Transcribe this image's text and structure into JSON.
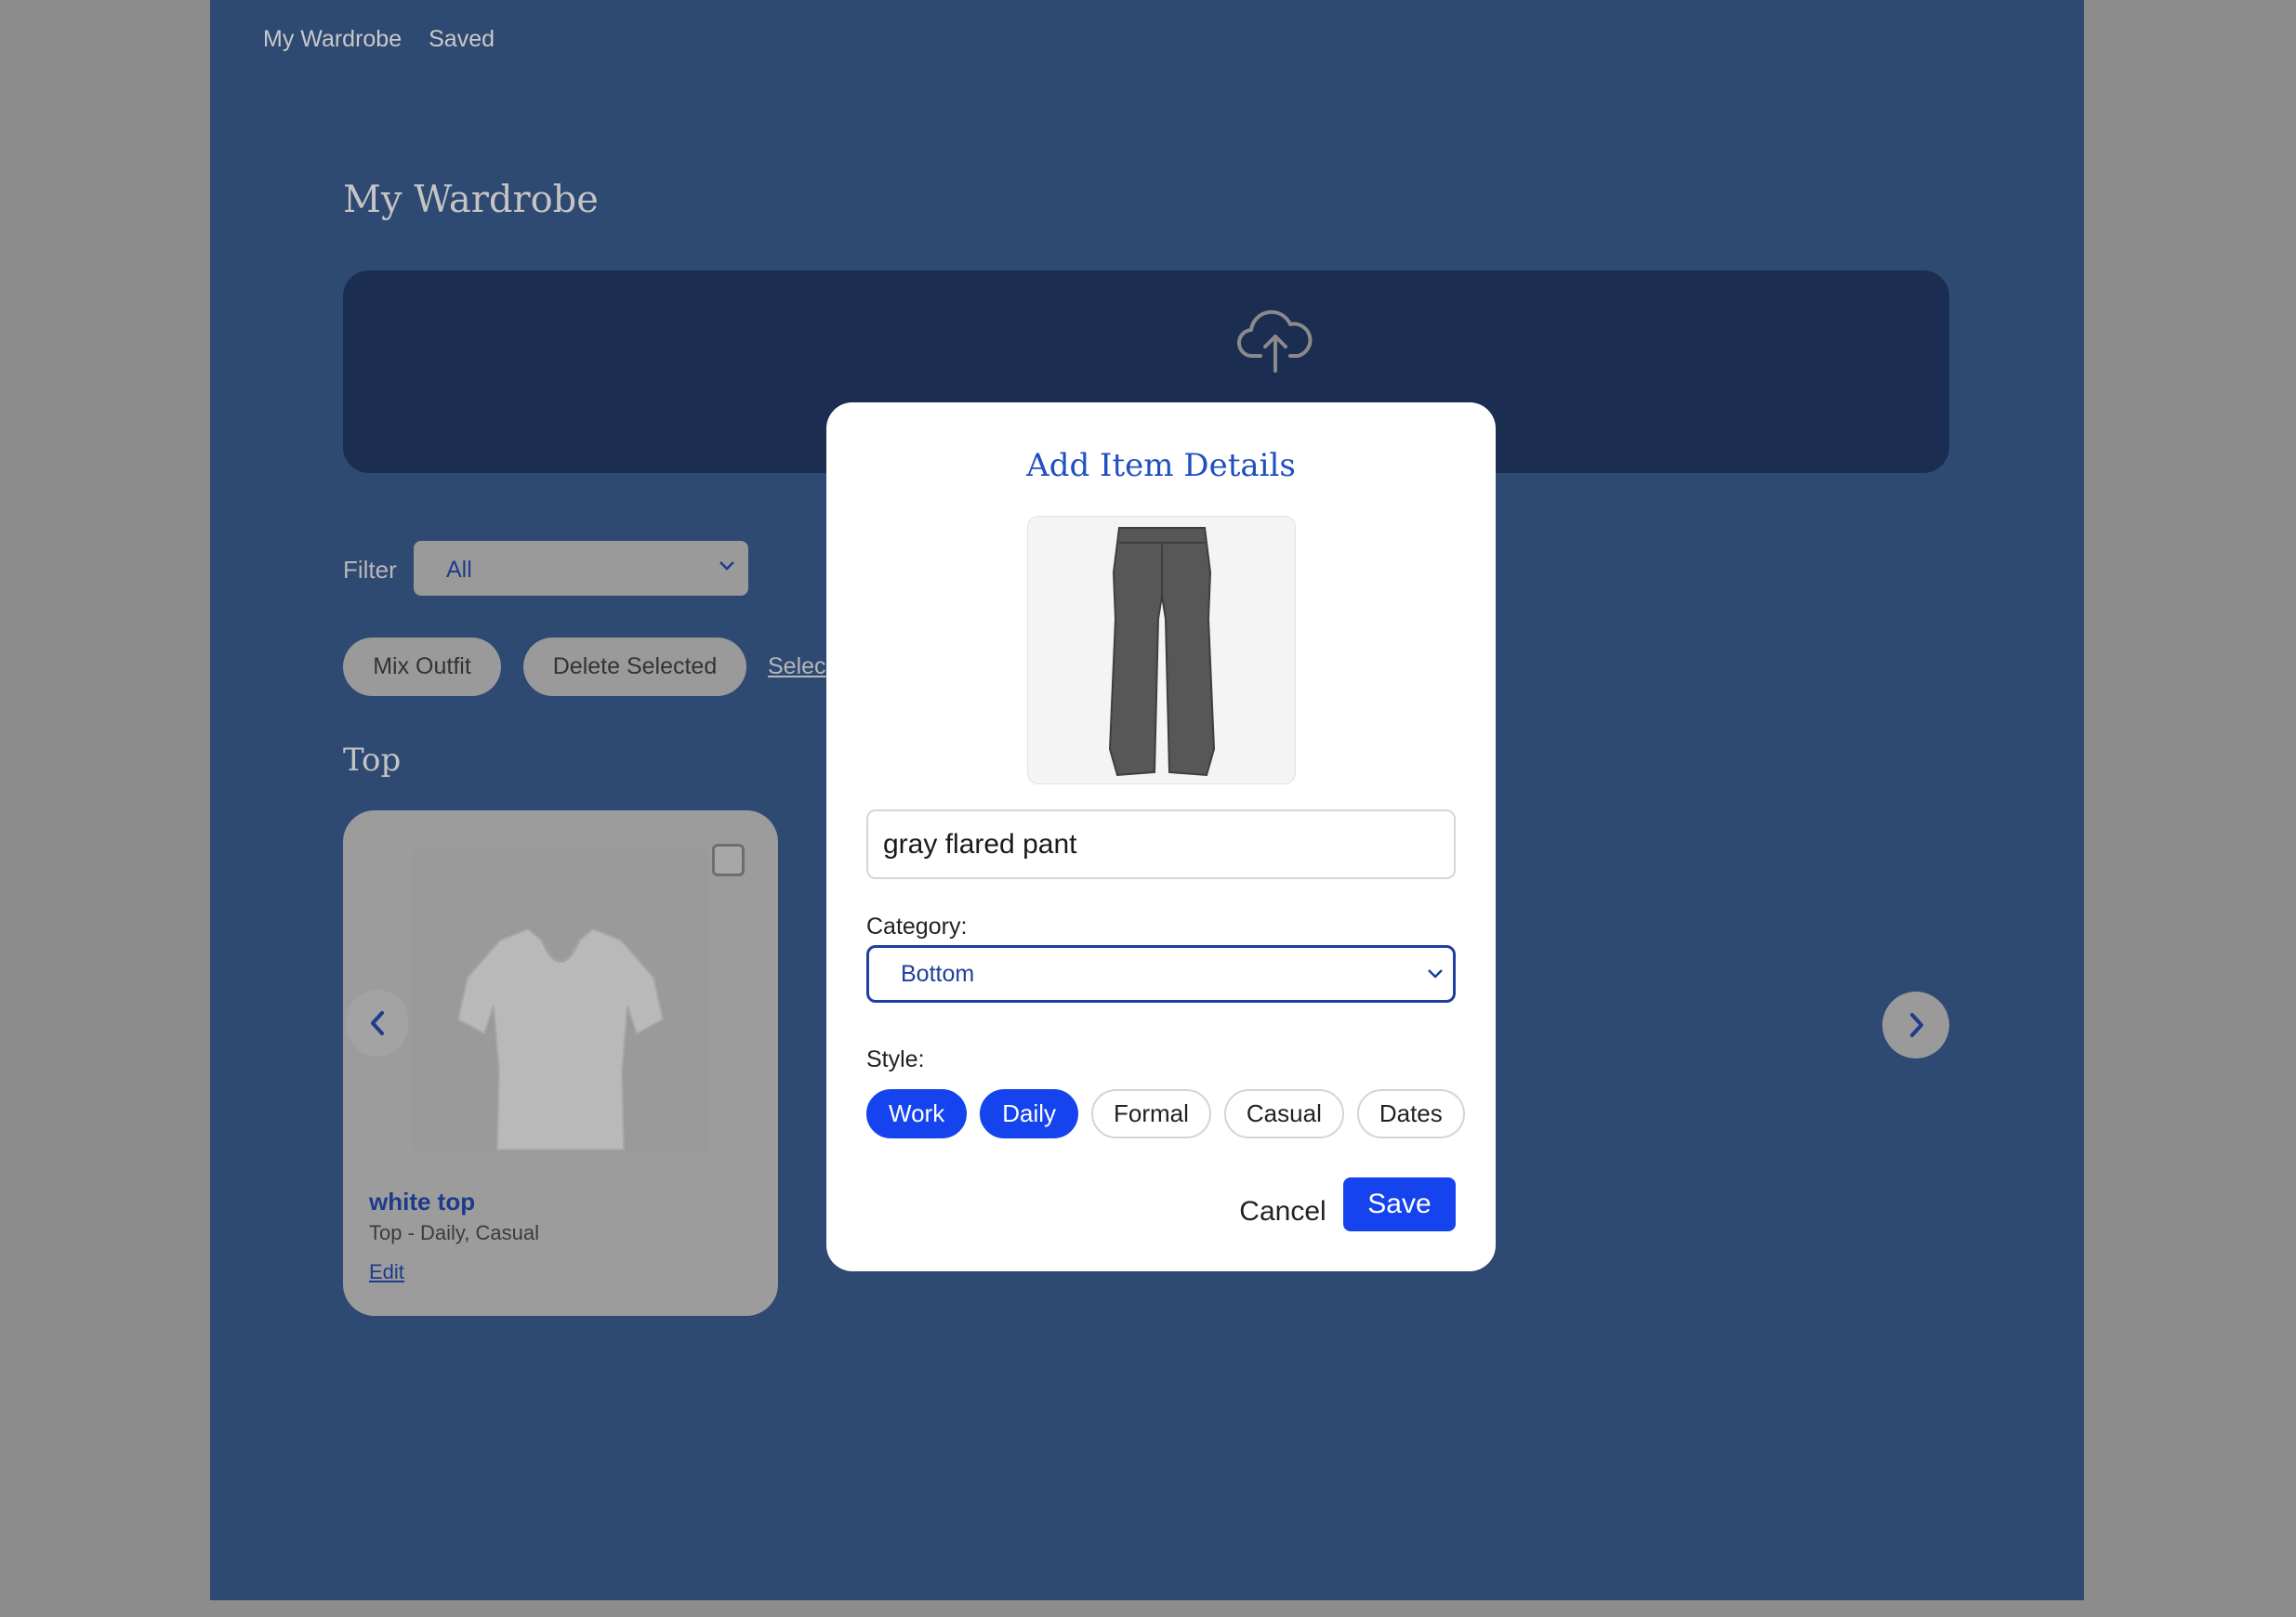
{
  "nav": {
    "items": [
      "My Wardrobe",
      "Saved"
    ]
  },
  "page": {
    "title": "My Wardrobe"
  },
  "upload": {
    "icon": "cloud-upload-icon"
  },
  "filter": {
    "label": "Filter",
    "value": "All"
  },
  "actions": {
    "mix_label": "Mix Outfit",
    "delete_label": "Delete Selected",
    "select_label": "Selec"
  },
  "section": {
    "title": "Top"
  },
  "card": {
    "name": "white top",
    "meta": "Top - Daily, Casual",
    "edit_label": "Edit"
  },
  "modal": {
    "title": "Add Item Details",
    "name_value": "gray flared pant",
    "category_label": "Category:",
    "category_value": "Bottom",
    "style_label": "Style:",
    "styles": [
      {
        "label": "Work",
        "selected": true
      },
      {
        "label": "Daily",
        "selected": true
      },
      {
        "label": "Formal",
        "selected": false
      },
      {
        "label": "Casual",
        "selected": false
      },
      {
        "label": "Dates",
        "selected": false
      }
    ],
    "cancel_label": "Cancel",
    "save_label": "Save"
  },
  "colors": {
    "page_bg": "#2e4972",
    "overlay": "#8c8c8c",
    "accent": "#1544ef",
    "title_blue": "#1f4fc0"
  }
}
